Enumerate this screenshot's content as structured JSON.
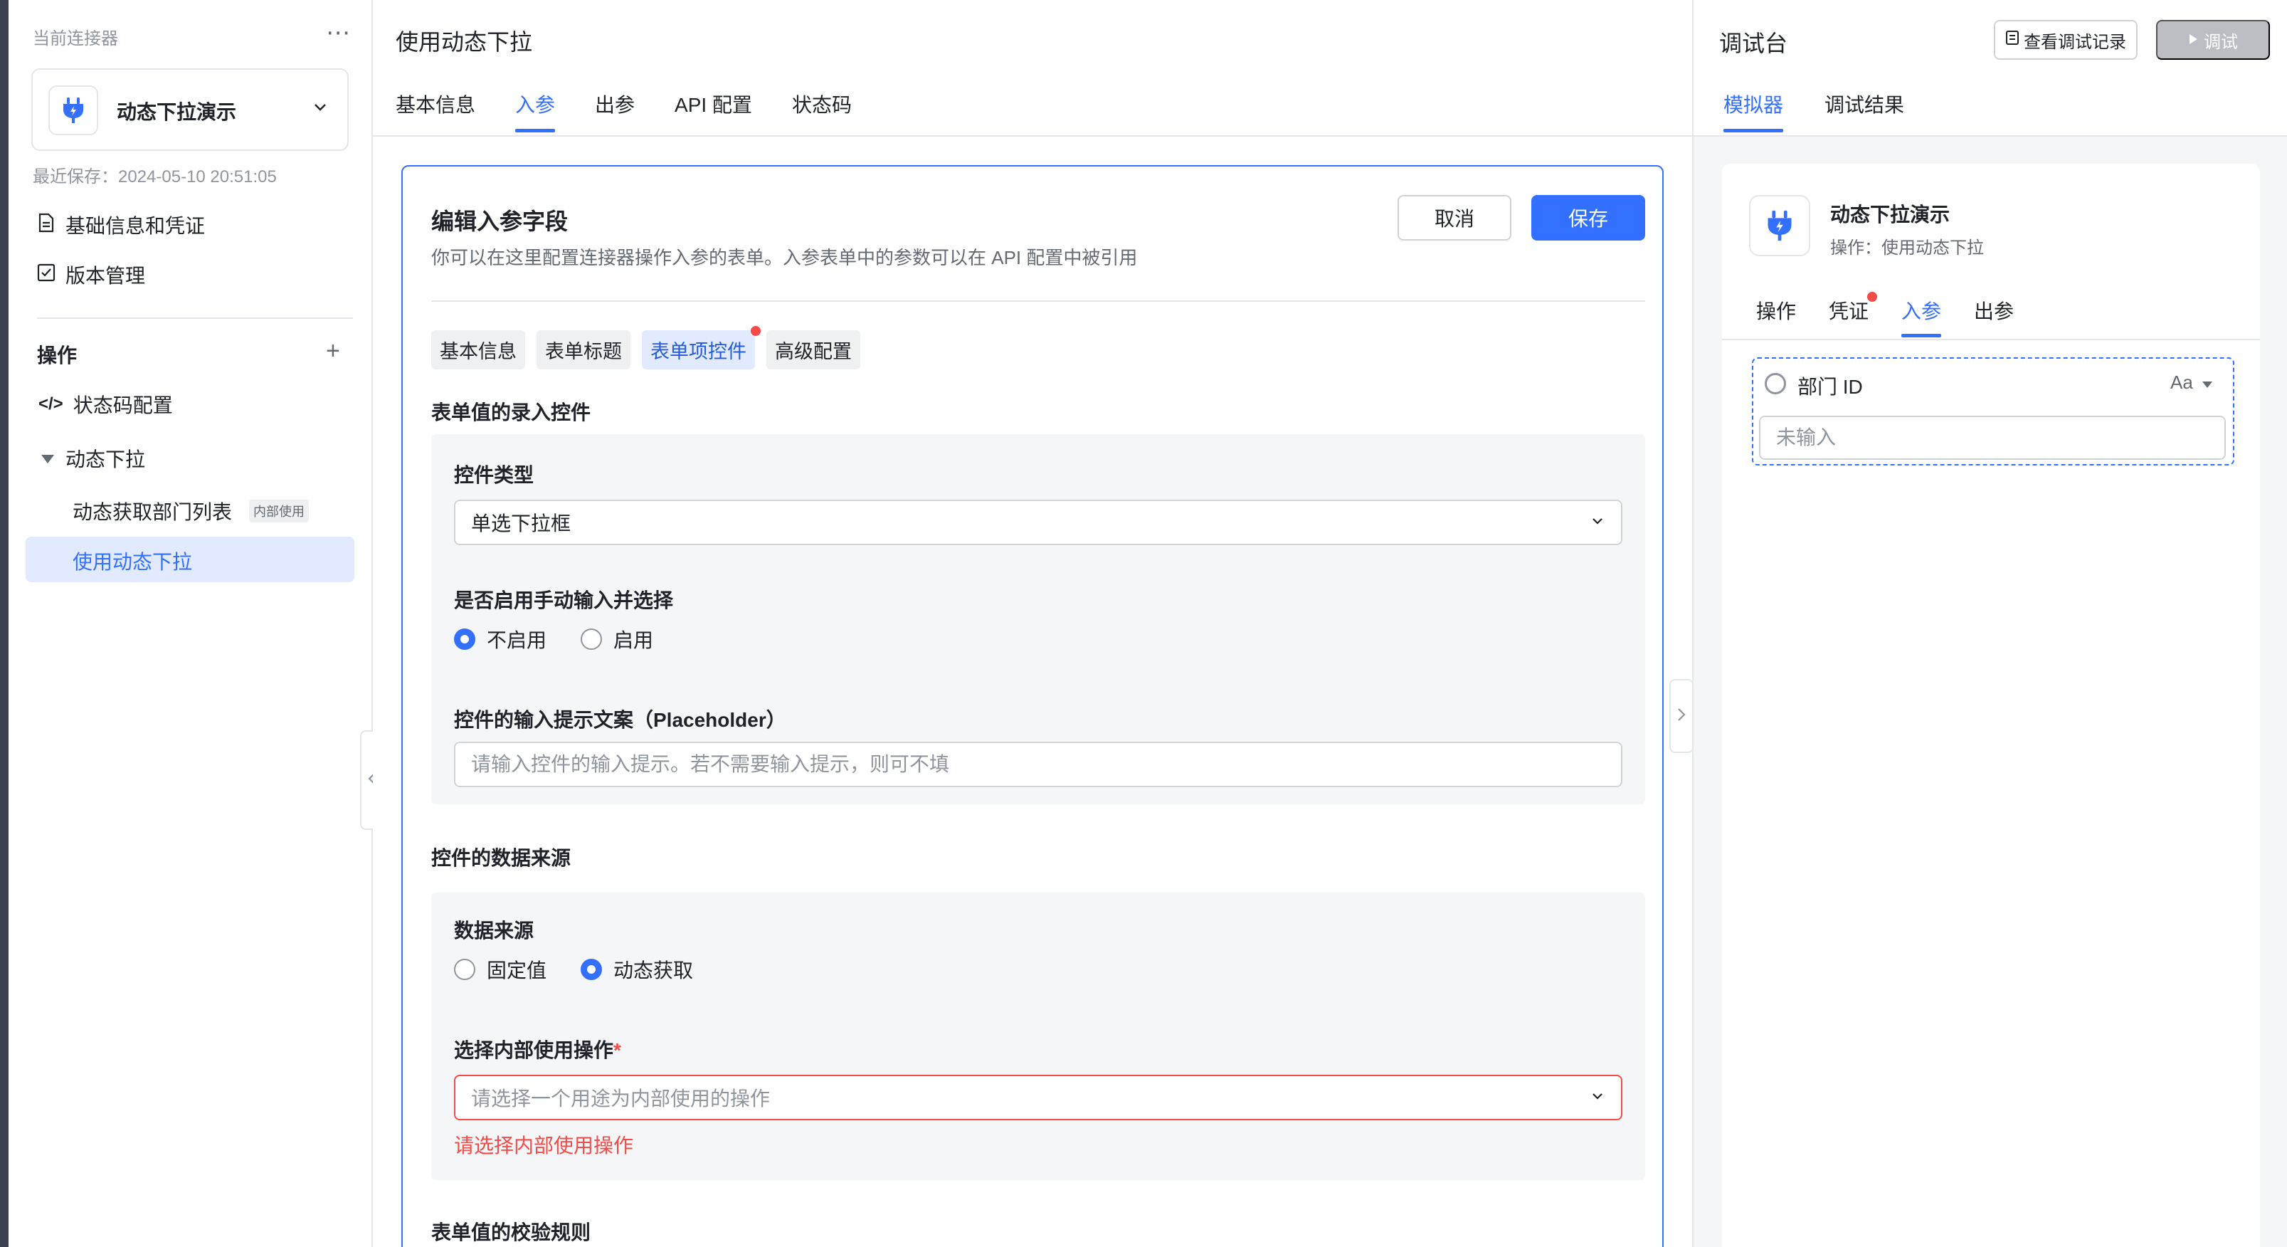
{
  "sidebar": {
    "caption": "当前连接器",
    "connector_name": "动态下拉演示",
    "last_saved": "最近保存：2024-05-10 20:51:05",
    "nav": [
      {
        "label": "基础信息和凭证",
        "icon": "document-icon"
      },
      {
        "label": "版本管理",
        "icon": "version-icon"
      }
    ],
    "operations_title": "操作",
    "operations": {
      "status_code": "状态码配置",
      "group": "动态下拉",
      "child_1": "动态获取部门列表",
      "child_1_badge": "内部使用",
      "child_2": "使用动态下拉"
    }
  },
  "main": {
    "title": "使用动态下拉",
    "tabs": [
      "基本信息",
      "入参",
      "出参",
      "API 配置",
      "状态码"
    ],
    "active_tab": "入参",
    "editor": {
      "title": "编辑入参字段",
      "description": "你可以在这里配置连接器操作入参的表单。入参表单中的参数可以在 API 配置中被引用",
      "cancel_label": "取消",
      "save_label": "保存",
      "chips": [
        "基本信息",
        "表单标题",
        "表单项控件",
        "高级配置"
      ],
      "active_chip": "表单项控件",
      "control_section": {
        "title": "表单值的录入控件",
        "type_label": "控件类型",
        "type_value": "单选下拉框",
        "manual_label": "是否启用手动输入并选择",
        "manual_options": [
          "不启用",
          "启用"
        ],
        "manual_selected": "不启用",
        "placeholder_label": "控件的输入提示文案（Placeholder）",
        "placeholder_input_hint": "请输入控件的输入提示。若不需要输入提示，则可不填"
      },
      "data_section": {
        "title": "控件的数据来源",
        "source_label": "数据来源",
        "source_options": [
          "固定值",
          "动态获取"
        ],
        "source_selected": "动态获取",
        "operation_label": "选择内部使用操作",
        "required_mark": "*",
        "operation_placeholder": "请选择一个用途为内部使用的操作",
        "operation_error": "请选择内部使用操作"
      },
      "validation_title": "表单值的校验规则"
    }
  },
  "debug": {
    "title": "调试台",
    "history_label": "查看调试记录",
    "run_label": "调试",
    "tabs": [
      "模拟器",
      "调试结果"
    ],
    "active_tab": "模拟器",
    "simulator": {
      "connector_name": "动态下拉演示",
      "operation_line": "操作：使用动态下拉",
      "tabs": [
        "操作",
        "凭证",
        "入参",
        "出参"
      ],
      "active_tab": "入参",
      "param_name": "部门 ID",
      "param_type_glyph": "Aa",
      "param_input_placeholder": "未输入"
    }
  },
  "colors": {
    "accent": "#3370ff",
    "error": "#f54a45",
    "active_bg": "#e1eaff"
  }
}
